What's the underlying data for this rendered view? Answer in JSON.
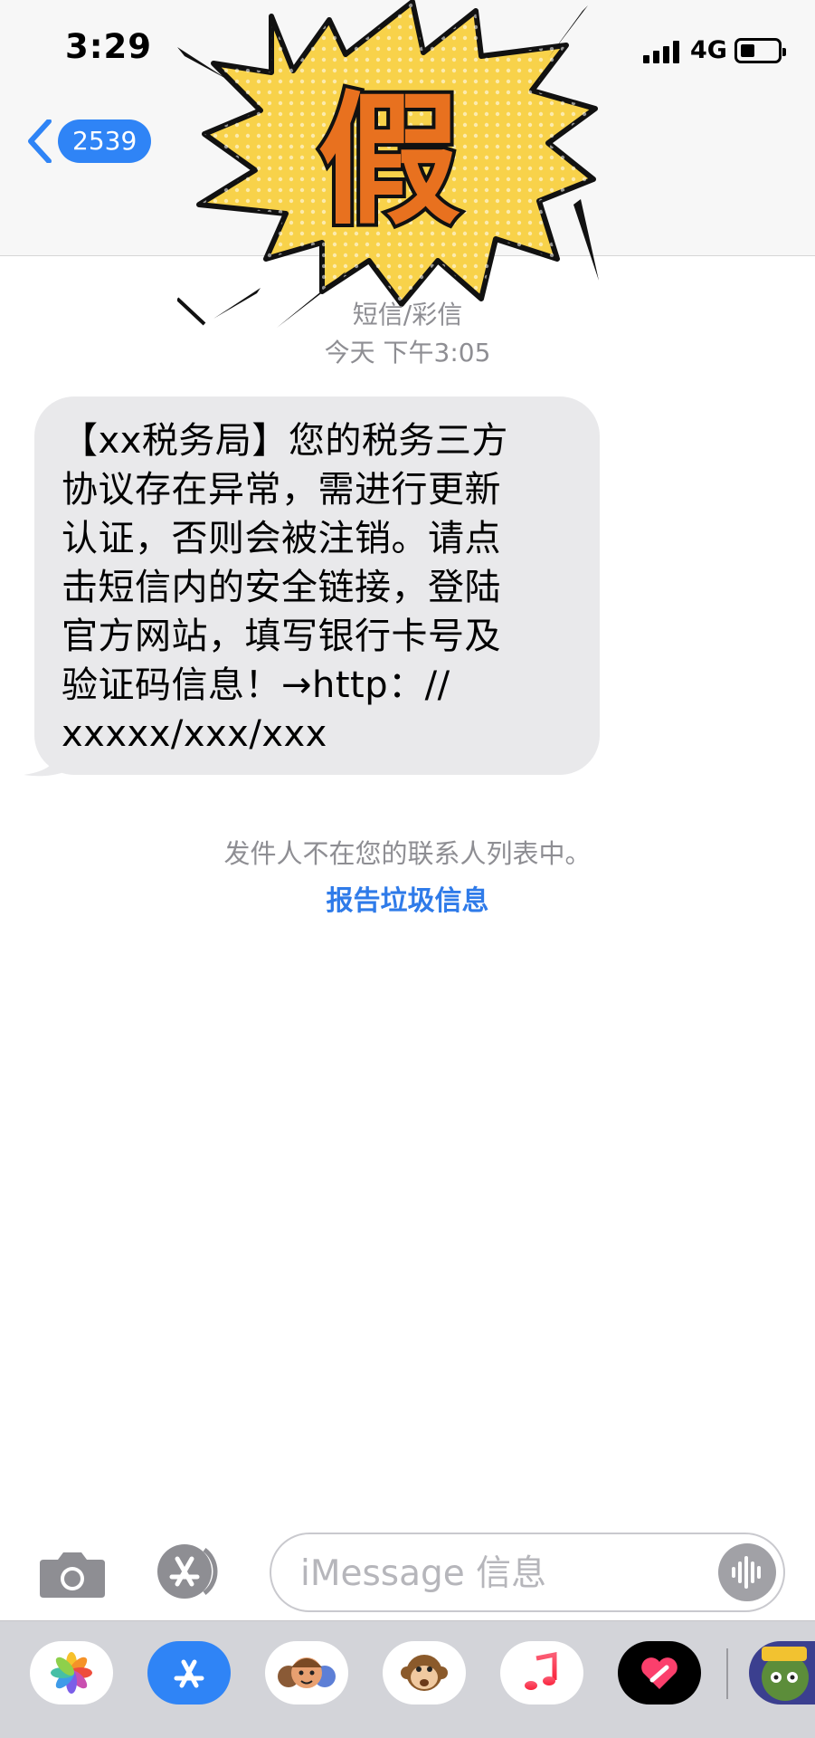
{
  "status_bar": {
    "time": "3:29",
    "network": "4G"
  },
  "nav": {
    "back_count": "2539"
  },
  "overlay": {
    "stamp_text": "假"
  },
  "thread": {
    "message_type": "短信/彩信",
    "timestamp": "今天 下午3:05",
    "message_lines": [
      "【xx税务局】您的税务三方",
      "协议存在异常，需进行更新",
      "认证，否则会被注销。请点",
      "击短信内的安全链接，登陆",
      "官方网站，填写银行卡号及",
      "验证码信息！→http：//",
      "xxxxx/xxx/xxx"
    ],
    "unknown_sender_notice": "发件人不在您的联系人列表中。",
    "report_junk_label": "报告垃圾信息"
  },
  "compose": {
    "placeholder": "iMessage 信息"
  },
  "app_drawer": {
    "apps": [
      "photos-icon",
      "app-store-icon",
      "memoji-icon",
      "animoji-monkey-icon",
      "music-icon",
      "digital-touch-icon",
      "game-icon"
    ]
  },
  "colors": {
    "accent": "#2f84f6",
    "bubble": "#e9e9eb",
    "stamp": "#e8711f",
    "burst": "#f8d24a"
  }
}
